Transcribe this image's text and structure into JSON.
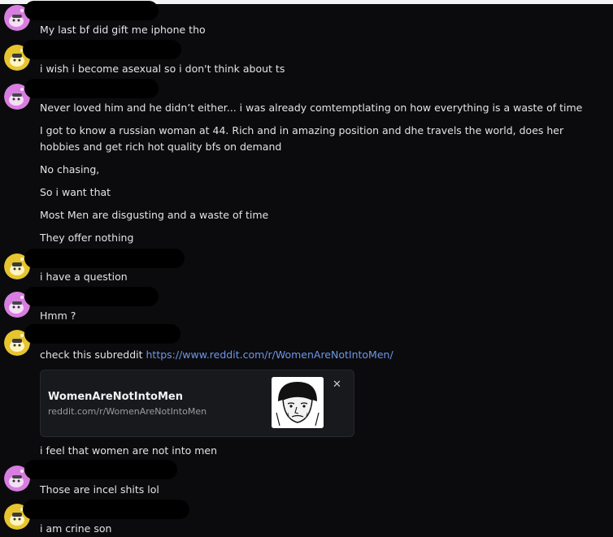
{
  "messages": [
    {
      "text": "My last bf did gift me iphone tho"
    },
    {
      "text": "i wish i become asexual so i don't think about ts"
    },
    {
      "text": "Never loved him and he didn’t either... i was already comtemptlating on how everything is a waste of time"
    },
    {
      "text": "I got to know a russian woman at 44. Rich and in amazing position and dhe travels the world, does her hobbies and get rich hot quality bfs on demand"
    },
    {
      "text": "No chasing,"
    },
    {
      "text": "So i want that"
    },
    {
      "text": "Most Men are disgusting and a waste of time"
    },
    {
      "text": "They offer nothing"
    },
    {
      "text": "i have a question"
    },
    {
      "text": "Hmm ?"
    },
    {
      "text": "check this subreddit ",
      "link": "https://www.reddit.com/r/WomenAreNotIntoMen/"
    },
    {
      "text": "i feel that women are not into men"
    },
    {
      "text": "Those are incel shits lol"
    },
    {
      "text": "i am crine son"
    }
  ],
  "embed": {
    "title": "WomenAreNotIntoMen",
    "domain": "reddit.com/r/WomenAreNotIntoMen",
    "close_icon": "✕"
  },
  "avatars": [
    {
      "icon": "snoo-avatar-icon",
      "color": "#d87ee0"
    },
    {
      "icon": "snoo-avatar-icon",
      "color": "#e6c52e"
    }
  ]
}
